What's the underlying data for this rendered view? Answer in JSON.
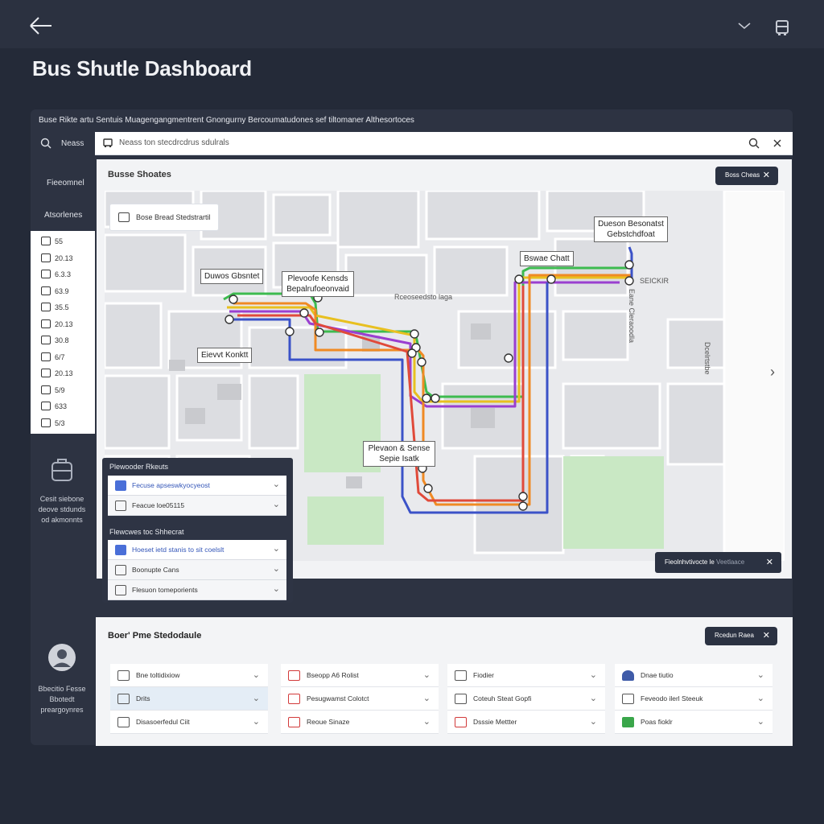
{
  "app": {
    "title": "Bus Shutle Dashboard"
  },
  "breadcrumb": "Buse Rikte artu Sentuis Muagengangmentrent Gnongurny Bercoumatudones sef tiltomaner Althesortoces",
  "sidebar": {
    "search_label": "Neass",
    "section_1": "Fieeomnel",
    "section_2": "Atsorlenes",
    "items": [
      {
        "icon": "bus-icon",
        "value": "55"
      },
      {
        "icon": "calendar-icon",
        "value": "20.13"
      },
      {
        "icon": "shield-icon",
        "value": "6.3.3"
      },
      {
        "icon": "grid-icon",
        "value": "63.9"
      },
      {
        "icon": "chart-icon",
        "value": "35.5"
      },
      {
        "icon": "clipboard-icon",
        "value": "20.13"
      },
      {
        "icon": "grid-icon",
        "value": "30.8"
      },
      {
        "icon": "bus-icon",
        "value": "6/7"
      },
      {
        "icon": "calendar-icon",
        "value": "20.13"
      },
      {
        "icon": "chart-icon",
        "value": "5/9"
      },
      {
        "icon": "grid-icon",
        "value": "633"
      },
      {
        "icon": "bus-icon",
        "value": "5/3"
      }
    ],
    "promo_text": "Cesit siebone deove stdunds od akmonnts",
    "user_label": "Bbecitio Fesse Bbotedt preargoynres"
  },
  "toolbar": {
    "search_placeholder": "Neass ton stecdrcdrus sdulrals"
  },
  "map": {
    "title": "Busse Shoates",
    "close_label": "Boss Cheas",
    "filter_chip": "Bose Bread Stedstrartil",
    "labels": {
      "label_1": "Duwos Gbsntet",
      "label_2": "Plevoofe Kensds Bepalrufoeonvaid",
      "label_3": "Eievvt Konktt",
      "label_4": "Dueson Besonatst Gebstchdfoat",
      "label_5": "Bswae Chatt",
      "label_6": "Plevaon & Sense Sepie Isatk",
      "label_7": "Rceoseedsto laga",
      "label_8": "SEICKIR",
      "label_9": "Eane Cleraoodla",
      "label_10": "Dcelrtstbe"
    },
    "notification": {
      "text": "Fieolnhvtivocte le",
      "tag": "Veetlaace"
    }
  },
  "float_panel": {
    "section_1": "Plewooder Rkeuts",
    "section_1_rows": [
      {
        "icon": "list-icon",
        "label": "Fecuse apseswkyocyeost",
        "active": true
      },
      {
        "icon": "bus-icon",
        "label": "Feacue loe05115",
        "active": false
      }
    ],
    "section_2": "Flewcwes toc Shhecrat",
    "section_2_rows": [
      {
        "icon": "grid-icon",
        "label": "Hoeset ietd stanis to sit coelslt",
        "active": true
      },
      {
        "icon": "bus-icon",
        "label": "Boonupte Cans",
        "active": false
      },
      {
        "icon": "route-icon",
        "label": "Flesuon tomeporients",
        "active": false
      }
    ]
  },
  "schedule": {
    "title": "Boer' Pme Stedodaule",
    "close_label": "Rcedun Raea",
    "columns": [
      {
        "rows": [
          {
            "icon": "bus-icon",
            "icon_style": "",
            "label": "Bne toltidixiow",
            "highlight": false
          },
          {
            "icon": "bus-icon",
            "icon_style": "",
            "label": "Drits",
            "highlight": true
          },
          {
            "icon": "bus-icon",
            "icon_style": "",
            "label": "Disasoerfedul Ciit",
            "highlight": false
          }
        ]
      },
      {
        "rows": [
          {
            "icon": "bus-icon",
            "icon_style": "red",
            "label": "Bseopp A6 Rolist",
            "highlight": false
          },
          {
            "icon": "route-icon",
            "icon_style": "red",
            "label": "Pesugwamst Colotct",
            "highlight": false
          },
          {
            "icon": "bus-icon",
            "icon_style": "red",
            "label": "Reoue Sinaze",
            "highlight": false
          }
        ]
      },
      {
        "rows": [
          {
            "icon": "bus-icon",
            "icon_style": "",
            "label": "Fiodier",
            "highlight": false
          },
          {
            "icon": "person-icon",
            "icon_style": "",
            "label": "Coteuh Steat Gopfi",
            "highlight": false
          },
          {
            "icon": "bus-icon",
            "icon_style": "red",
            "label": "Dsssie Mettter",
            "highlight": false
          }
        ]
      },
      {
        "rows": [
          {
            "icon": "person-icon",
            "icon_style": "blue",
            "label": "Dnae tiutio",
            "highlight": false
          },
          {
            "icon": "bus-icon",
            "icon_style": "",
            "label": "Feveodo ilerl Steeuk",
            "highlight": false
          },
          {
            "icon": "check-icon",
            "icon_style": "green",
            "label": "Poas fioklr",
            "highlight": false
          }
        ]
      }
    ]
  },
  "colors": {
    "background": "#242a38",
    "panel_dark": "#2b3242",
    "route_green": "#3dbb4f",
    "route_orange": "#f08a24",
    "route_purple": "#9a3fd0",
    "route_blue": "#3b52c8",
    "route_yellow": "#e8c020",
    "route_red": "#e04a3a",
    "park_green": "#c9e8c4"
  }
}
